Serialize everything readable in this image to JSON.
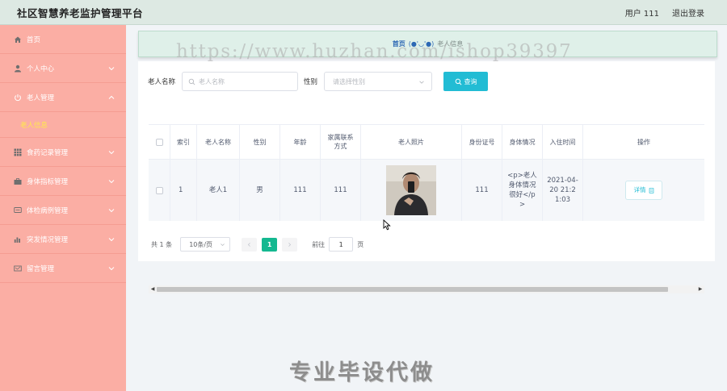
{
  "header": {
    "title": "社区智慧养老监护管理平台",
    "user": "用户 111",
    "logout": "退出登录"
  },
  "sidebar": {
    "items": [
      {
        "label": "首页",
        "icon": "home-icon"
      },
      {
        "label": "个人中心",
        "icon": "user-icon"
      },
      {
        "label": "老人管理",
        "icon": "power-icon",
        "expanded": true,
        "sub": "老人信息"
      },
      {
        "label": "食药记录管理",
        "icon": "grid-icon"
      },
      {
        "label": "身体指标管理",
        "icon": "briefcase-icon"
      },
      {
        "label": "体检病例管理",
        "icon": "message-icon"
      },
      {
        "label": "突发情况管理",
        "icon": "chart-icon"
      },
      {
        "label": "留言管理",
        "icon": "mail-icon"
      }
    ]
  },
  "breadcrumb": {
    "home": "首页",
    "face": "(●'◡'●)",
    "current": "老人信息"
  },
  "watermark": "https://www.huzhan.com/ishop39397",
  "search": {
    "name_label": "老人名称",
    "name_placeholder": "老人名称",
    "gender_label": "性别",
    "gender_placeholder": "请选择性别",
    "button": "查询"
  },
  "table": {
    "columns": [
      "索引",
      "老人名称",
      "性别",
      "年龄",
      "家属联系方式",
      "老人照片",
      "身份证号",
      "身体情况",
      "入住时间",
      "操作"
    ],
    "rows": [
      {
        "index": "1",
        "name": "老人1",
        "gender": "男",
        "age": "111",
        "contact": "111",
        "id_card": "111",
        "condition": "<p>老人身体情况很好</p>",
        "checkin": "2021-04-20 21:21:03",
        "action": "详情"
      }
    ]
  },
  "pager": {
    "total": "共 1 条",
    "page_size": "10条/页",
    "current": "1",
    "goto": "前往",
    "goto_value": "1",
    "unit": "页"
  },
  "promo": "专业毕设代做",
  "colors": {
    "sidebar": "#fbaea4",
    "accent": "#22bcd4",
    "page_active": "#14b890",
    "header": "#dde9e3"
  }
}
